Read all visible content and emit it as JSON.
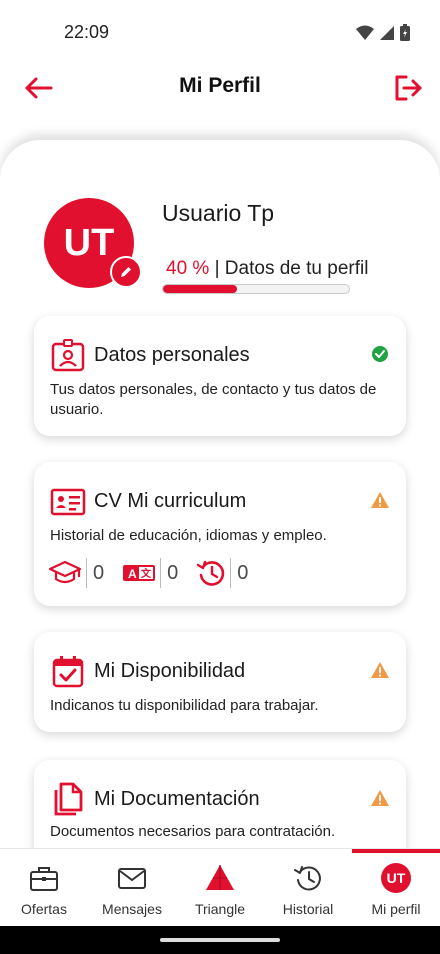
{
  "status_bar": {
    "time": "22:09"
  },
  "header": {
    "title": "Mi Perfil"
  },
  "profile": {
    "initials": "UT",
    "name": "Usuario Tp",
    "progress_percent": "40 %",
    "progress_label": "| Datos de tu perfil",
    "progress_fraction": 0.4
  },
  "cards": [
    {
      "title": "Datos personales",
      "description": "Tus datos personales, de contacto y tus datos de usuario.",
      "status": "complete"
    },
    {
      "title": "CV Mi curriculum",
      "description": "Historial de educación, idiomas y empleo.",
      "status": "warning",
      "counts": {
        "education": "0",
        "languages": "0",
        "history": "0"
      }
    },
    {
      "title": "Mi Disponibilidad",
      "description": "Indicanos tu disponibilidad para trabajar.",
      "status": "warning"
    },
    {
      "title": "Mi Documentación",
      "description": "Documentos necesarios para contratación.",
      "status": "warning"
    }
  ],
  "bottom_nav": {
    "items": [
      {
        "label": "Ofertas"
      },
      {
        "label": "Mensajes"
      },
      {
        "label": "Triangle"
      },
      {
        "label": "Historial"
      },
      {
        "label": "Mi perfil",
        "avatar": "UT",
        "active": true
      }
    ]
  },
  "colors": {
    "accent": "#e0102e",
    "success": "#21a345",
    "warning": "#f09a46"
  }
}
